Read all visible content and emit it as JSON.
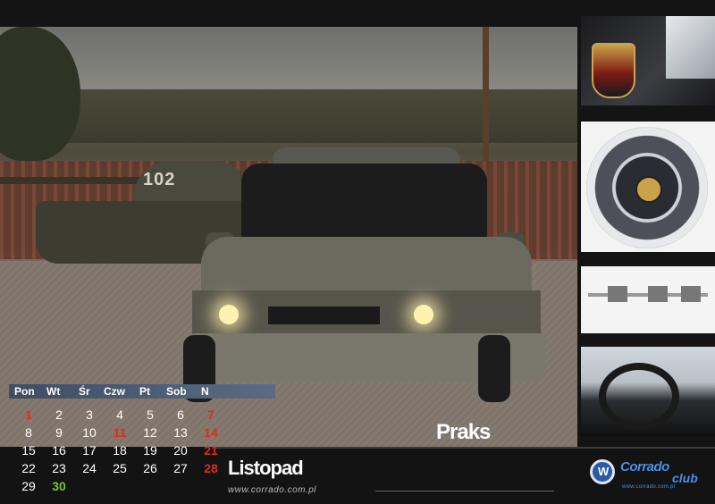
{
  "photo": {
    "tank_number": "102"
  },
  "title": {
    "name": "Praks"
  },
  "calendar": {
    "month": "Listopad",
    "weekdays": [
      "Pon",
      "Wt",
      "Śr",
      "Czw",
      "Pt",
      "Sob",
      "N"
    ],
    "weeks": [
      [
        "1",
        "2",
        "3",
        "4",
        "5",
        "6",
        "7"
      ],
      [
        "8",
        "9",
        "10",
        "11",
        "12",
        "13",
        "14"
      ],
      [
        "15",
        "16",
        "17",
        "18",
        "19",
        "20",
        "21"
      ],
      [
        "22",
        "23",
        "24",
        "25",
        "26",
        "27",
        "28"
      ],
      [
        "29",
        "30",
        "",
        "",
        "",
        "",
        ""
      ]
    ],
    "holiday_color": "#e02a1e",
    "highlight_color": "#7bc62a"
  },
  "footer": {
    "url": "www.corrado.com.pl"
  },
  "logo": {
    "word": "Corrado",
    "club": "club",
    "small": "www.corrado.com.pl"
  }
}
